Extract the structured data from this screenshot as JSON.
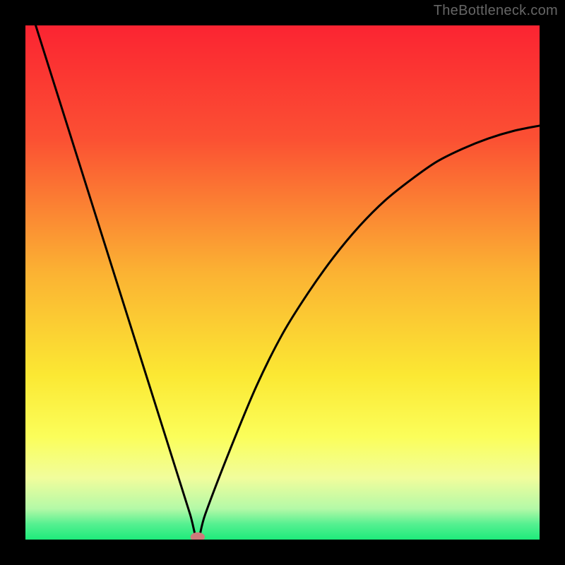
{
  "watermark": "TheBottleneck.com",
  "chart_data": {
    "type": "line",
    "title": "",
    "xlabel": "",
    "ylabel": "",
    "xlim": [
      0,
      100
    ],
    "ylim": [
      0,
      100
    ],
    "curve": {
      "name": "bottleneck-curve",
      "color": "#000000",
      "x": [
        2,
        5,
        8,
        11,
        14,
        17,
        20,
        23,
        26,
        29,
        32,
        33.5,
        35,
        40,
        45,
        50,
        55,
        60,
        65,
        70,
        75,
        80,
        85,
        90,
        95,
        100
      ],
      "y": [
        100,
        90.5,
        81,
        71.5,
        62,
        52.5,
        43,
        33.5,
        24,
        14.5,
        5,
        0,
        5,
        18,
        30,
        40,
        48,
        55,
        61,
        66,
        70,
        73.5,
        76,
        78,
        79.5,
        80.5
      ]
    },
    "marker": {
      "name": "sweet-spot",
      "x": 33.5,
      "y": 0.5,
      "rx": 1.4,
      "ry": 0.9,
      "color": "#cf7b7b"
    },
    "background_gradient_stops": [
      {
        "offset": 0,
        "color": "#fb2432"
      },
      {
        "offset": 22,
        "color": "#fb5033"
      },
      {
        "offset": 48,
        "color": "#fbb233"
      },
      {
        "offset": 68,
        "color": "#fbe833"
      },
      {
        "offset": 80,
        "color": "#fbfe5a"
      },
      {
        "offset": 88,
        "color": "#f1fd9c"
      },
      {
        "offset": 94,
        "color": "#b4f9a7"
      },
      {
        "offset": 97,
        "color": "#55f090"
      },
      {
        "offset": 100,
        "color": "#1eeb7b"
      }
    ]
  }
}
